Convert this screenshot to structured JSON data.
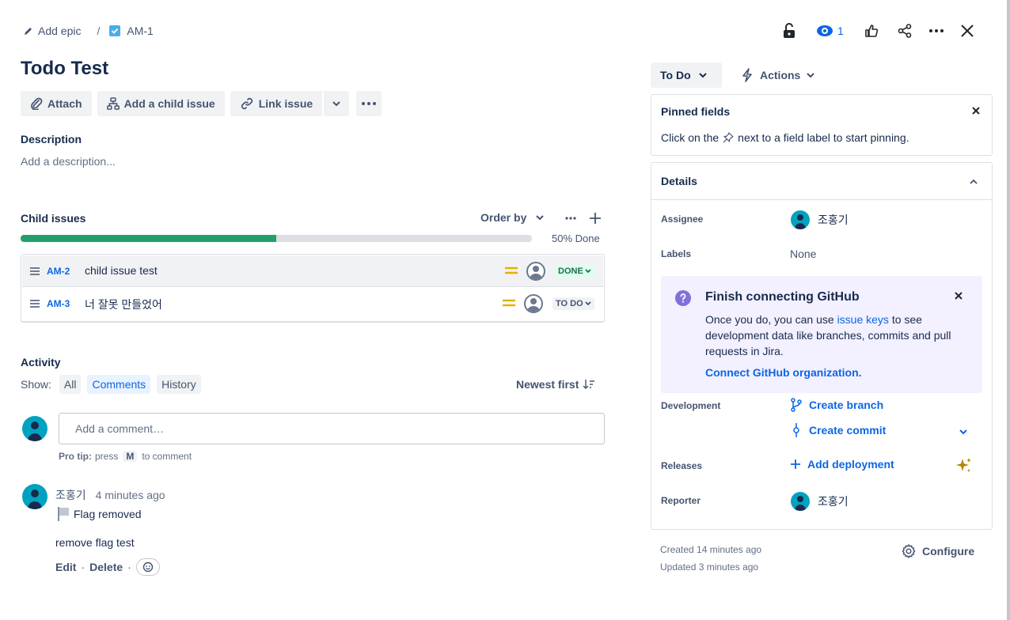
{
  "header": {
    "add_epic": "Add epic",
    "separator": "/",
    "issue_key": "AM-1",
    "watch_count": "1"
  },
  "issue": {
    "title": "Todo Test",
    "toolbar": {
      "attach": "Attach",
      "add_child": "Add a child issue",
      "link_issue": "Link issue"
    },
    "description_label": "Description",
    "description_placeholder": "Add a description..."
  },
  "child_issues": {
    "title": "Child issues",
    "order_by": "Order by",
    "progress_text": "50% Done",
    "progress_fraction": 0.5,
    "items": [
      {
        "key": "AM-2",
        "summary": "child issue test",
        "status": "DONE"
      },
      {
        "key": "AM-3",
        "summary": "너 잘못 만들었어",
        "status": "TO DO"
      }
    ]
  },
  "activity": {
    "title": "Activity",
    "show_label": "Show:",
    "filters": [
      "All",
      "Comments",
      "History"
    ],
    "sort": "Newest first",
    "comment_placeholder": "Add a comment…",
    "pro_tip_label": "Pro tip:",
    "pro_tip_press": "press",
    "pro_tip_key": "M",
    "pro_tip_suffix": "to comment",
    "comment": {
      "author": "조홍기",
      "time": "4 minutes ago",
      "flag_text": "Flag removed",
      "body": "remove flag test",
      "edit": "Edit",
      "delete": "Delete",
      "dot": "·"
    }
  },
  "sidebar": {
    "status": "To Do",
    "actions": "Actions",
    "pinned": {
      "title": "Pinned fields",
      "text_before": "Click on the",
      "text_after": "next to a field label to start pinning."
    },
    "details": {
      "title": "Details",
      "assignee_label": "Assignee",
      "assignee": "조홍기",
      "labels_label": "Labels",
      "labels_value": "None",
      "github": {
        "title": "Finish connecting GitHub",
        "text_before": "Once you do, you can use",
        "link": "issue keys",
        "text_after": "to see development data like branches, commits and pull requests in Jira.",
        "connect": "Connect GitHub organization."
      },
      "development_label": "Development",
      "create_branch": "Create branch",
      "create_commit": "Create commit",
      "releases_label": "Releases",
      "add_deployment": "Add deployment",
      "reporter_label": "Reporter",
      "reporter": "조홍기"
    },
    "created": "Created 14 minutes ago",
    "updated": "Updated 3 minutes ago",
    "configure": "Configure"
  },
  "colors": {
    "primary": "#0c66e4",
    "progress_done": "#22a06b",
    "progress_track": "#dcdfe4",
    "done_lozenge_bg": "#dcfff1",
    "done_lozenge_fg": "#216e4e",
    "todo_lozenge_bg": "#f1f2f4",
    "priority": "#e2b203",
    "github_panel": "#f3f0ff",
    "github_icon": "#8270db",
    "sparkle": "#b38600",
    "avatar": "#00a3bf"
  }
}
